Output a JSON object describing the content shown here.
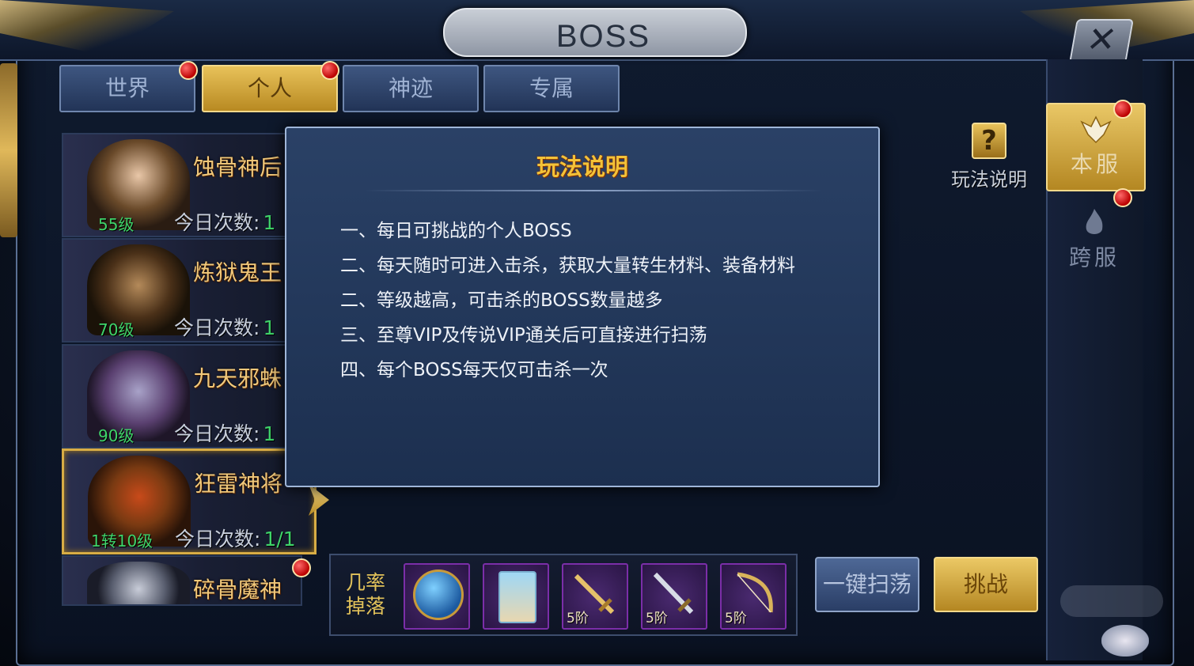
{
  "window": {
    "title": "BOSS",
    "close_label": "✕"
  },
  "tabs": [
    {
      "label": "世界",
      "active": false,
      "badge": true
    },
    {
      "label": "个人",
      "active": true,
      "badge": true
    },
    {
      "label": "神迹",
      "active": false,
      "badge": false
    },
    {
      "label": "专属",
      "active": false,
      "badge": false
    }
  ],
  "bosses": [
    {
      "name": "蚀骨神后",
      "level": "55级",
      "count_label": "今日次数:",
      "count": "1",
      "selected": false
    },
    {
      "name": "炼狱鬼王",
      "level": "70级",
      "count_label": "今日次数:",
      "count": "1",
      "selected": false
    },
    {
      "name": "九天邪蛛",
      "level": "90级",
      "count_label": "今日次数:",
      "count": "1",
      "selected": false
    },
    {
      "name": "狂雷神将",
      "level": "1转10级",
      "count_label": "今日次数:",
      "count": "1/1",
      "selected": true
    },
    {
      "name": "碎骨魔神",
      "level": "",
      "count_label": "",
      "count": "",
      "selected": false,
      "badge": true
    }
  ],
  "help": {
    "label": "玩法说明",
    "icon": "question-icon"
  },
  "side_tabs": [
    {
      "label": "本服",
      "active": true,
      "badge": true,
      "icon": "local-server-emblem-icon"
    },
    {
      "label": "跨服",
      "active": false,
      "badge": true,
      "icon": "cross-server-flame-icon"
    }
  ],
  "drops": {
    "label": "几率掉落",
    "items": [
      {
        "icon": "treasure-globe-chest-icon",
        "stage": ""
      },
      {
        "icon": "pet-card-icon",
        "stage": ""
      },
      {
        "icon": "golden-sword-icon",
        "stage": "5阶"
      },
      {
        "icon": "silver-sword-icon",
        "stage": "5阶"
      },
      {
        "icon": "bow-icon",
        "stage": "5阶"
      }
    ]
  },
  "actions": {
    "sweep": "一键扫荡",
    "challenge": "挑战"
  },
  "modal": {
    "title": "玩法说明",
    "rules": [
      "一、每日可挑战的个人BOSS",
      "二、每天随时可进入击杀，获取大量转生材料、装备材料",
      "二、等级越高，可击杀的BOSS数量越多",
      "三、至尊VIP及传说VIP通关后可直接进行扫荡",
      "四、每个BOSS每天仅可击杀一次"
    ]
  },
  "colors": {
    "gold": "#e8c25a",
    "panel": "#1c2f4f",
    "accent_green": "#3fd46a",
    "badge_red": "#d01010"
  }
}
